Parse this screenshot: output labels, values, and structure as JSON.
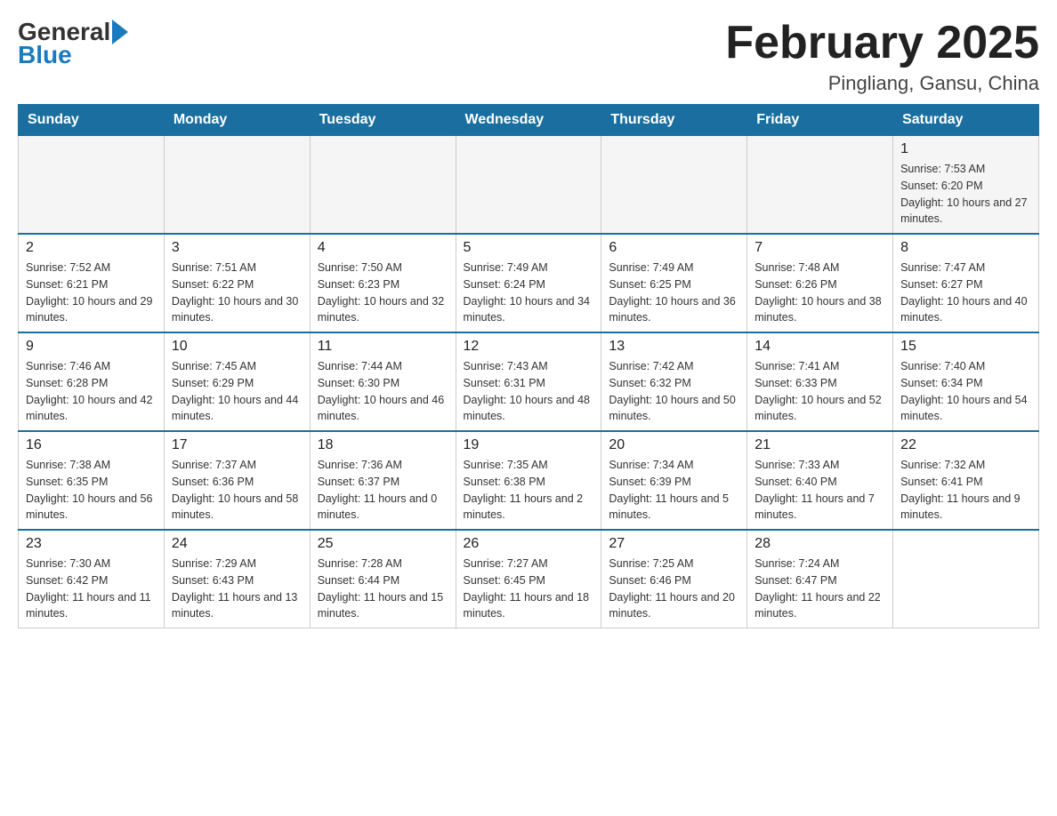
{
  "header": {
    "logo_general": "General",
    "logo_blue": "Blue",
    "month_title": "February 2025",
    "location": "Pingliang, Gansu, China"
  },
  "days_of_week": [
    "Sunday",
    "Monday",
    "Tuesday",
    "Wednesday",
    "Thursday",
    "Friday",
    "Saturday"
  ],
  "weeks": [
    [
      {
        "day": "",
        "sunrise": "",
        "sunset": "",
        "daylight": ""
      },
      {
        "day": "",
        "sunrise": "",
        "sunset": "",
        "daylight": ""
      },
      {
        "day": "",
        "sunrise": "",
        "sunset": "",
        "daylight": ""
      },
      {
        "day": "",
        "sunrise": "",
        "sunset": "",
        "daylight": ""
      },
      {
        "day": "",
        "sunrise": "",
        "sunset": "",
        "daylight": ""
      },
      {
        "day": "",
        "sunrise": "",
        "sunset": "",
        "daylight": ""
      },
      {
        "day": "1",
        "sunrise": "Sunrise: 7:53 AM",
        "sunset": "Sunset: 6:20 PM",
        "daylight": "Daylight: 10 hours and 27 minutes."
      }
    ],
    [
      {
        "day": "2",
        "sunrise": "Sunrise: 7:52 AM",
        "sunset": "Sunset: 6:21 PM",
        "daylight": "Daylight: 10 hours and 29 minutes."
      },
      {
        "day": "3",
        "sunrise": "Sunrise: 7:51 AM",
        "sunset": "Sunset: 6:22 PM",
        "daylight": "Daylight: 10 hours and 30 minutes."
      },
      {
        "day": "4",
        "sunrise": "Sunrise: 7:50 AM",
        "sunset": "Sunset: 6:23 PM",
        "daylight": "Daylight: 10 hours and 32 minutes."
      },
      {
        "day": "5",
        "sunrise": "Sunrise: 7:49 AM",
        "sunset": "Sunset: 6:24 PM",
        "daylight": "Daylight: 10 hours and 34 minutes."
      },
      {
        "day": "6",
        "sunrise": "Sunrise: 7:49 AM",
        "sunset": "Sunset: 6:25 PM",
        "daylight": "Daylight: 10 hours and 36 minutes."
      },
      {
        "day": "7",
        "sunrise": "Sunrise: 7:48 AM",
        "sunset": "Sunset: 6:26 PM",
        "daylight": "Daylight: 10 hours and 38 minutes."
      },
      {
        "day": "8",
        "sunrise": "Sunrise: 7:47 AM",
        "sunset": "Sunset: 6:27 PM",
        "daylight": "Daylight: 10 hours and 40 minutes."
      }
    ],
    [
      {
        "day": "9",
        "sunrise": "Sunrise: 7:46 AM",
        "sunset": "Sunset: 6:28 PM",
        "daylight": "Daylight: 10 hours and 42 minutes."
      },
      {
        "day": "10",
        "sunrise": "Sunrise: 7:45 AM",
        "sunset": "Sunset: 6:29 PM",
        "daylight": "Daylight: 10 hours and 44 minutes."
      },
      {
        "day": "11",
        "sunrise": "Sunrise: 7:44 AM",
        "sunset": "Sunset: 6:30 PM",
        "daylight": "Daylight: 10 hours and 46 minutes."
      },
      {
        "day": "12",
        "sunrise": "Sunrise: 7:43 AM",
        "sunset": "Sunset: 6:31 PM",
        "daylight": "Daylight: 10 hours and 48 minutes."
      },
      {
        "day": "13",
        "sunrise": "Sunrise: 7:42 AM",
        "sunset": "Sunset: 6:32 PM",
        "daylight": "Daylight: 10 hours and 50 minutes."
      },
      {
        "day": "14",
        "sunrise": "Sunrise: 7:41 AM",
        "sunset": "Sunset: 6:33 PM",
        "daylight": "Daylight: 10 hours and 52 minutes."
      },
      {
        "day": "15",
        "sunrise": "Sunrise: 7:40 AM",
        "sunset": "Sunset: 6:34 PM",
        "daylight": "Daylight: 10 hours and 54 minutes."
      }
    ],
    [
      {
        "day": "16",
        "sunrise": "Sunrise: 7:38 AM",
        "sunset": "Sunset: 6:35 PM",
        "daylight": "Daylight: 10 hours and 56 minutes."
      },
      {
        "day": "17",
        "sunrise": "Sunrise: 7:37 AM",
        "sunset": "Sunset: 6:36 PM",
        "daylight": "Daylight: 10 hours and 58 minutes."
      },
      {
        "day": "18",
        "sunrise": "Sunrise: 7:36 AM",
        "sunset": "Sunset: 6:37 PM",
        "daylight": "Daylight: 11 hours and 0 minutes."
      },
      {
        "day": "19",
        "sunrise": "Sunrise: 7:35 AM",
        "sunset": "Sunset: 6:38 PM",
        "daylight": "Daylight: 11 hours and 2 minutes."
      },
      {
        "day": "20",
        "sunrise": "Sunrise: 7:34 AM",
        "sunset": "Sunset: 6:39 PM",
        "daylight": "Daylight: 11 hours and 5 minutes."
      },
      {
        "day": "21",
        "sunrise": "Sunrise: 7:33 AM",
        "sunset": "Sunset: 6:40 PM",
        "daylight": "Daylight: 11 hours and 7 minutes."
      },
      {
        "day": "22",
        "sunrise": "Sunrise: 7:32 AM",
        "sunset": "Sunset: 6:41 PM",
        "daylight": "Daylight: 11 hours and 9 minutes."
      }
    ],
    [
      {
        "day": "23",
        "sunrise": "Sunrise: 7:30 AM",
        "sunset": "Sunset: 6:42 PM",
        "daylight": "Daylight: 11 hours and 11 minutes."
      },
      {
        "day": "24",
        "sunrise": "Sunrise: 7:29 AM",
        "sunset": "Sunset: 6:43 PM",
        "daylight": "Daylight: 11 hours and 13 minutes."
      },
      {
        "day": "25",
        "sunrise": "Sunrise: 7:28 AM",
        "sunset": "Sunset: 6:44 PM",
        "daylight": "Daylight: 11 hours and 15 minutes."
      },
      {
        "day": "26",
        "sunrise": "Sunrise: 7:27 AM",
        "sunset": "Sunset: 6:45 PM",
        "daylight": "Daylight: 11 hours and 18 minutes."
      },
      {
        "day": "27",
        "sunrise": "Sunrise: 7:25 AM",
        "sunset": "Sunset: 6:46 PM",
        "daylight": "Daylight: 11 hours and 20 minutes."
      },
      {
        "day": "28",
        "sunrise": "Sunrise: 7:24 AM",
        "sunset": "Sunset: 6:47 PM",
        "daylight": "Daylight: 11 hours and 22 minutes."
      },
      {
        "day": "",
        "sunrise": "",
        "sunset": "",
        "daylight": ""
      }
    ]
  ]
}
